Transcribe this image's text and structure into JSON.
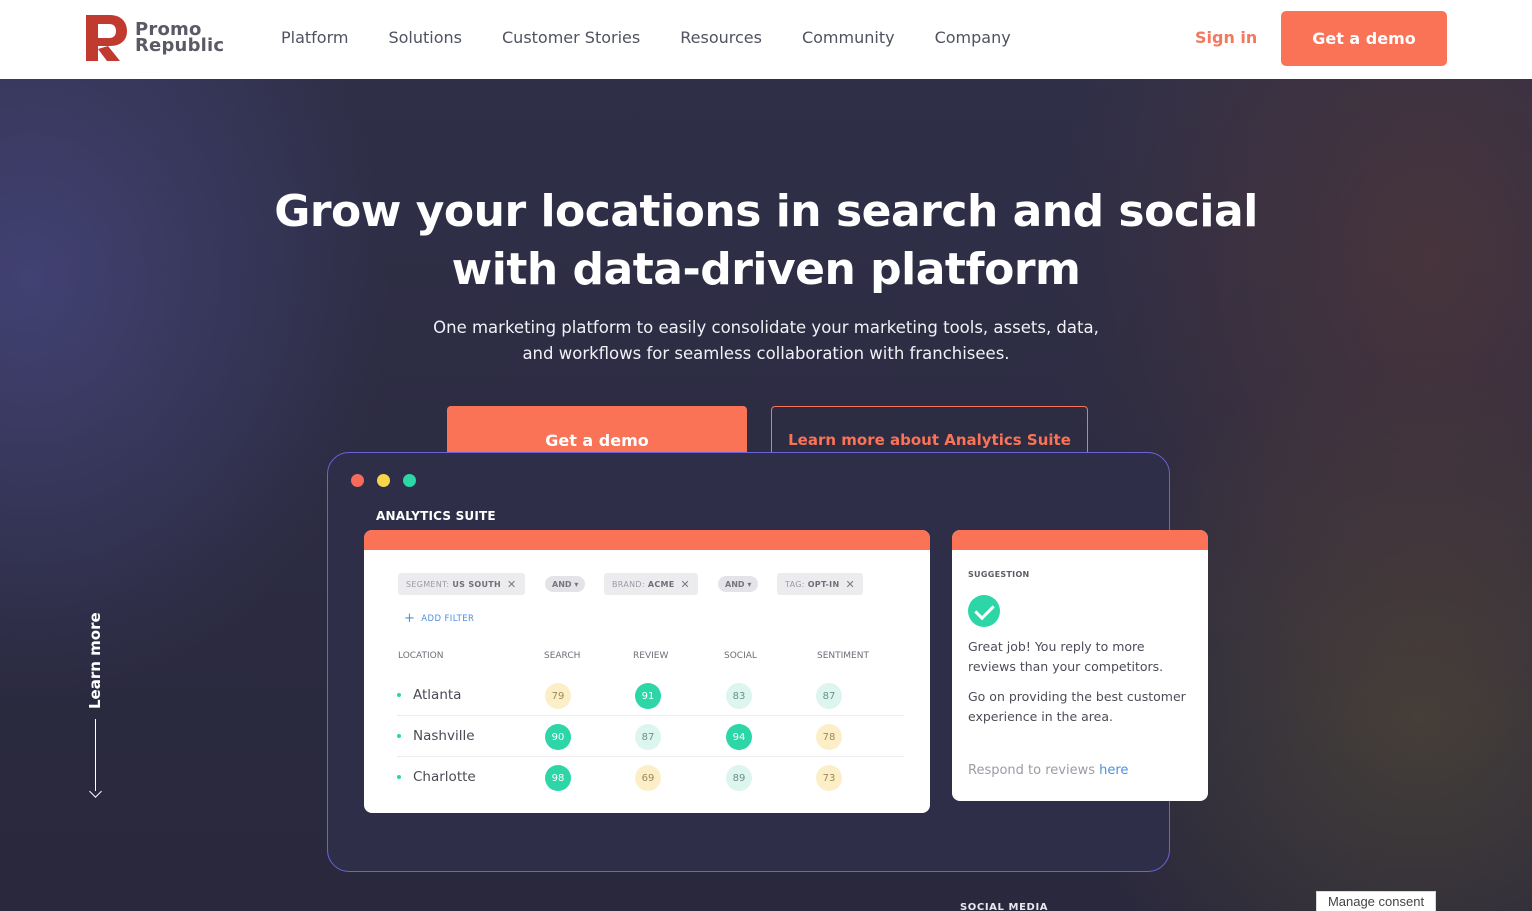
{
  "header": {
    "logo_line1": "Promo",
    "logo_line2": "Republic",
    "nav": [
      "Platform",
      "Solutions",
      "Customer Stories",
      "Resources",
      "Community",
      "Company"
    ],
    "sign_in": "Sign in",
    "cta": "Get a demo"
  },
  "hero": {
    "title_line1": "Grow your locations in search and social",
    "title_line2": "with data-driven platform",
    "subtitle_line1": "One marketing platform to easily consolidate your marketing tools, assets, data,",
    "subtitle_line2": "and workflows for seamless collaboration with franchisees.",
    "primary_cta": "Get a demo",
    "secondary_cta": "Learn more about Analytics Suite",
    "learn_more": "Learn more"
  },
  "mockup": {
    "title": "ANALYTICS  SUITE",
    "filters": [
      {
        "key": "SEGMENT:",
        "value": "US SOUTH"
      },
      {
        "key": "BRAND:",
        "value": "ACME"
      },
      {
        "key": "TAG:",
        "value": "OPT-IN"
      }
    ],
    "and_label": "AND ▾",
    "add_filter": "ADD FILTER",
    "columns": [
      "LOCATION",
      "SEARCH",
      "REVIEW",
      "SOCIAL",
      "SENTIMENT"
    ],
    "rows": [
      {
        "name": "Atlanta",
        "search": "79",
        "review": "91",
        "social": "83",
        "sentiment": "87"
      },
      {
        "name": "Nashville",
        "search": "90",
        "review": "87",
        "social": "94",
        "sentiment": "78"
      },
      {
        "name": "Charlotte",
        "search": "98",
        "review": "69",
        "social": "89",
        "sentiment": "73"
      }
    ],
    "suggestion": {
      "label": "SUGGESTION",
      "text1": "Great job! You reply to more reviews than your competitors.",
      "text2": "Go on providing the best customer experience in the area.",
      "link_prefix": "Respond to reviews ",
      "link": "here"
    },
    "next_section": "SOCIAL MEDIA"
  },
  "consent": "Manage consent",
  "colors": {
    "accent": "#fa7357",
    "teal": "#2dd6a6",
    "window_border": "#6b63d6"
  }
}
